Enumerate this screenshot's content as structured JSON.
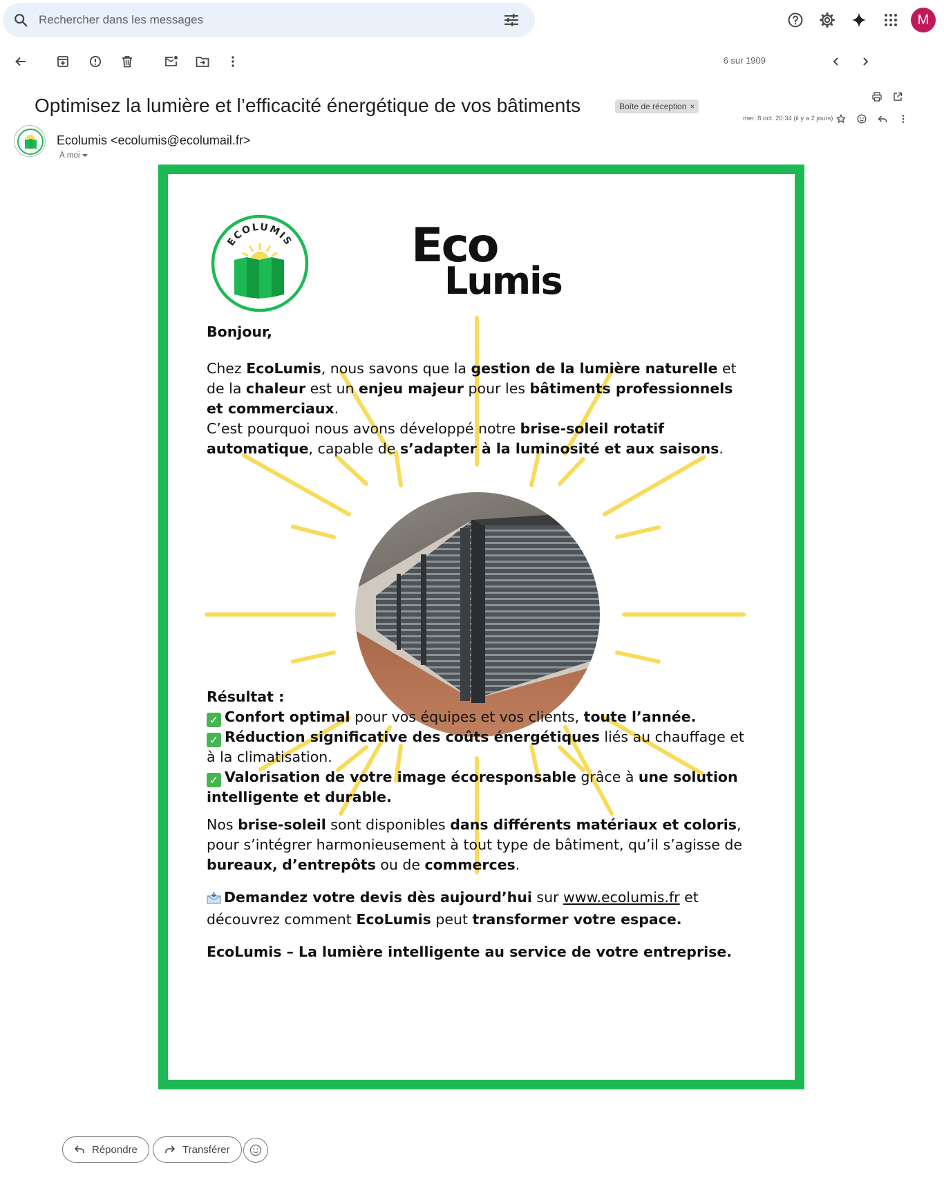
{
  "search": {
    "placeholder": "Rechercher dans les messages"
  },
  "topbar": {
    "avatar_letter": "M",
    "avatar_color": "#c2185b"
  },
  "toolbar": {
    "pager": "6 sur 1909"
  },
  "header": {
    "subject": "Optimisez la lumière et l’efficacité énergétique de vos bâtiments",
    "label": "Boîte de réception",
    "label_close": "×",
    "date": "mer. 8 oct. 20:34 (il y a 2 jours)",
    "sender": "Ecolumis <ecolumis@ecolumail.fr>",
    "to": "À moi"
  },
  "logo": {
    "ring_text": "ECOLUMIS",
    "wordmark_top": "Eco",
    "wordmark_bottom": "Lumis"
  },
  "body": {
    "greeting": "Bonjour,",
    "p1": {
      "a": "Chez ",
      "b": "EcoLumis",
      "c": ", nous savons que la ",
      "d": "gestion de la lumière naturelle",
      "e": " et de la ",
      "f": "chaleur",
      "g": " est un ",
      "h": "enjeu majeur",
      "i": " pour les ",
      "j": "bâtiments professionnels et commerciaux",
      "k": "."
    },
    "p2": {
      "a": "C’est pourquoi nous avons développé notre ",
      "b": "brise-soleil rotatif automatique",
      "c": ", capable de ",
      "d": "s’adapter à la luminosité et aux saisons",
      "e": "."
    },
    "result_title": "Résultat :",
    "r1": {
      "b": "Confort optimal",
      "c": " pour vos équipes et vos clients, ",
      "d": "toute l’année."
    },
    "r2": {
      "b": "Réduction significative des coûts énergétiques",
      "c": " liés au chauffage et à la climatisation."
    },
    "r3": {
      "b": "Valorisation de votre image écoresponsable",
      "c": " grâce à ",
      "d": "une solution intelligente et durable."
    },
    "p3": {
      "a": "Nos ",
      "b": "brise-soleil",
      "c": " sont disponibles ",
      "d": "dans différents matériaux et coloris",
      "e": ", pour s’intégrer harmonieusement à tout type de bâtiment, qu’il s’agisse de ",
      "f": "bureaux,",
      "g": " ",
      "h": "d’entrepôts",
      "i": " ou de ",
      "j": "commerces",
      "k": "."
    },
    "p4": {
      "b": "Demandez votre devis dès aujourd’hui",
      "c": " sur ",
      "link": "www.ecolumis.fr",
      "d": " et découvrez comment ",
      "e": "EcoLumis",
      "f": " peut ",
      "g": "transformer votre espace."
    },
    "signature": "EcoLumis – La lumière intelligente au service de votre entreprise."
  },
  "footer": {
    "reply": "Répondre",
    "forward": "Transférer"
  },
  "colors": {
    "frame": "#1db954",
    "sun": "#f7dc5c",
    "search_bg": "#eaf1fb"
  }
}
